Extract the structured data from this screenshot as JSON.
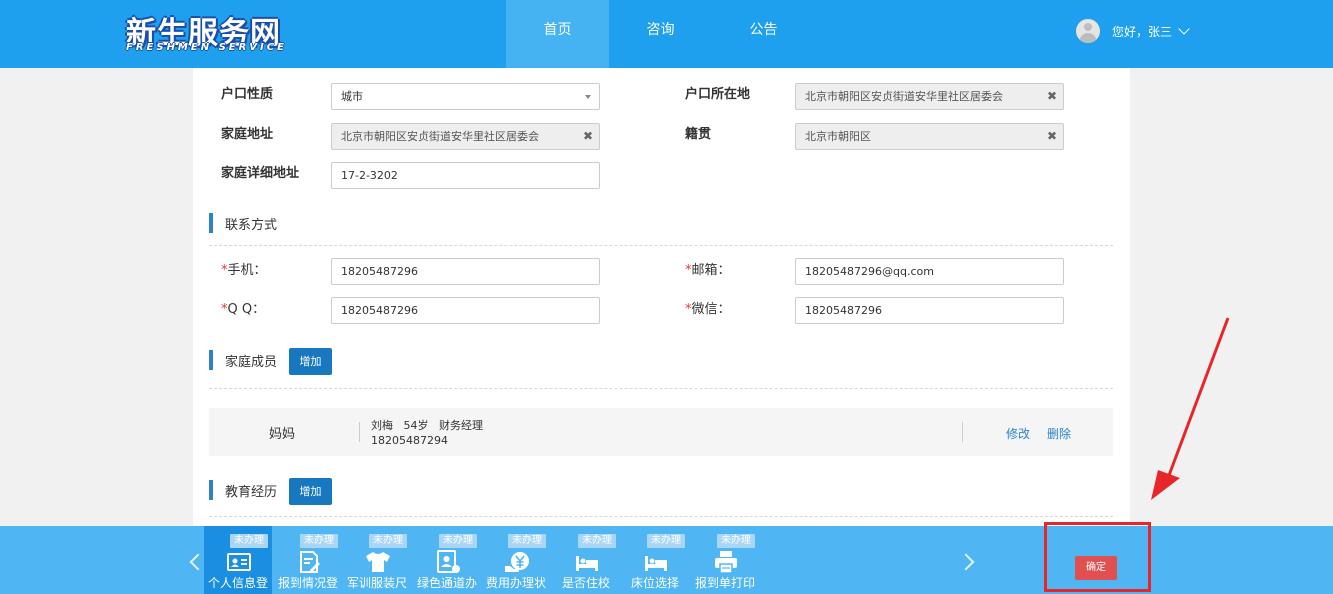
{
  "header": {
    "logo_cn": "新生服务网",
    "logo_en": "FRESHMEN SERVICE",
    "nav": [
      "首页",
      "咨询",
      "公告"
    ],
    "greeting": "您好，张三"
  },
  "address": {
    "hukou_type_label": "户口性质",
    "hukou_type_value": "城市",
    "hukou_location_label": "户口所在地",
    "hukou_location_value": "北京市朝阳区安贞街道安华里社区居委会",
    "home_address_label": "家庭地址",
    "home_address_value": "北京市朝阳区安贞街道安华里社区居委会",
    "native_place_label": "籍贯",
    "native_place_value": "北京市朝阳区",
    "detail_address_label": "家庭详细地址",
    "detail_address_value": "17-2-3202",
    "clear_symbol": "✖"
  },
  "contact": {
    "title": "联系方式",
    "required_mark": "*",
    "phone_label": "手机：",
    "phone_value": "18205487296",
    "email_label": "邮箱：",
    "email_value": "18205487296@qq.com",
    "qq_label": "Q Q：",
    "qq_value": "18205487296",
    "wechat_label": "微信：",
    "wechat_value": "18205487296"
  },
  "family": {
    "title": "家庭成员",
    "add_label": "增加",
    "members": [
      {
        "relation": "妈妈",
        "name": "刘梅",
        "age": "54岁",
        "job": "财务经理",
        "phone": "18205487294",
        "edit_label": "修改",
        "delete_label": "删除"
      }
    ]
  },
  "education": {
    "title": "教育经历",
    "add_label": "增加"
  },
  "steps": [
    {
      "status": "未办理",
      "label": "个人信息登",
      "icon": "id-card-icon"
    },
    {
      "status": "未办理",
      "label": "报到情况登",
      "icon": "edit-document-icon"
    },
    {
      "status": "未办理",
      "label": "军训服装尺",
      "icon": "tshirt-icon"
    },
    {
      "status": "未办理",
      "label": "绿色通道办",
      "icon": "id-badge-icon"
    },
    {
      "status": "未办理",
      "label": "费用办理状",
      "icon": "yuan-payment-icon"
    },
    {
      "status": "未办理",
      "label": "是否住校",
      "icon": "bed-icon"
    },
    {
      "status": "未办理",
      "label": "床位选择",
      "icon": "bed-select-icon"
    },
    {
      "status": "未办理",
      "label": "报到单打印",
      "icon": "printer-icon"
    }
  ],
  "confirm_label": "确定",
  "colors": {
    "header_bg": "#1ea0ee",
    "bottom_bg": "#4fb5f3",
    "accent": "#1778c0",
    "confirm": "#e05050",
    "highlight": "#e8262a"
  }
}
